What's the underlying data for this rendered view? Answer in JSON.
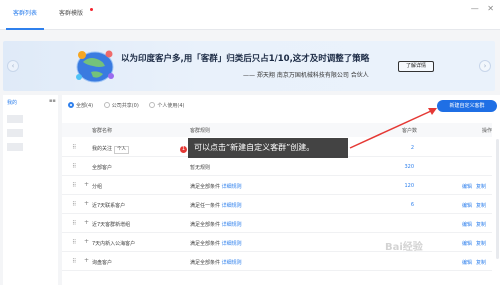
{
  "tabs": [
    {
      "label": "客群列表"
    },
    {
      "label": "客群模版"
    }
  ],
  "banner": {
    "title": "以为印度客户多,用「客群」归类后只占1/10,这才及时调整了策略",
    "subtitle": "—— 郑天翔 南京万国机械科技有限公司 合伙人",
    "button": "了解详情",
    "prev_icon": "chevron-left-icon",
    "next_icon": "chevron-right-icon"
  },
  "sidebar": {
    "label": "我的",
    "more": "▪▪"
  },
  "filters": [
    {
      "label": "全部(4)",
      "selected": true
    },
    {
      "label": "公司共享(0)",
      "selected": false
    },
    {
      "label": "个人使用(4)",
      "selected": false
    }
  ],
  "create_button": "新建自定义客群",
  "table": {
    "headers": {
      "name": "客群名称",
      "rule": "客群规则",
      "count": "客户数",
      "action": "操作"
    },
    "rows": [
      {
        "name": "我的关注",
        "tag": "个人",
        "rule": "",
        "link": "",
        "count": "2",
        "actions": [
          "",
          ""
        ]
      },
      {
        "name": "全部客户",
        "tag": "",
        "rule": "暂无规则",
        "link": "",
        "count": "320",
        "actions": [
          "",
          ""
        ]
      },
      {
        "name": "分组",
        "tag": "",
        "rule": "满足全部条件",
        "link": "详细规则",
        "count": "120",
        "actions": [
          "编辑",
          "复制"
        ]
      },
      {
        "name": "近7天联系客户",
        "tag": "",
        "rule": "满足任一条件",
        "link": "详细规则",
        "count": "6",
        "actions": [
          "编辑",
          "复制"
        ]
      },
      {
        "name": "近7天客群新增组",
        "tag": "",
        "rule": "满足全部条件",
        "link": "详细规则",
        "count": "",
        "actions": [
          "编辑",
          "复制"
        ]
      },
      {
        "name": "7天内新入公海客户",
        "tag": "",
        "rule": "满足全部条件",
        "link": "详细规则",
        "count": "",
        "actions": [
          "编辑",
          "复制"
        ]
      },
      {
        "name": "询盘客户",
        "tag": "",
        "rule": "满足全部条件",
        "link": "详细规则",
        "count": "",
        "actions": [
          "编辑",
          "复制"
        ]
      }
    ]
  },
  "annotation": {
    "number": "1",
    "text": "可以点击“新建自定义客群”创建。"
  },
  "watermark": "Bai经验",
  "colors": {
    "accent": "#1f6fe5",
    "annotation_bg": "#222222",
    "arrow": "#e53935"
  }
}
